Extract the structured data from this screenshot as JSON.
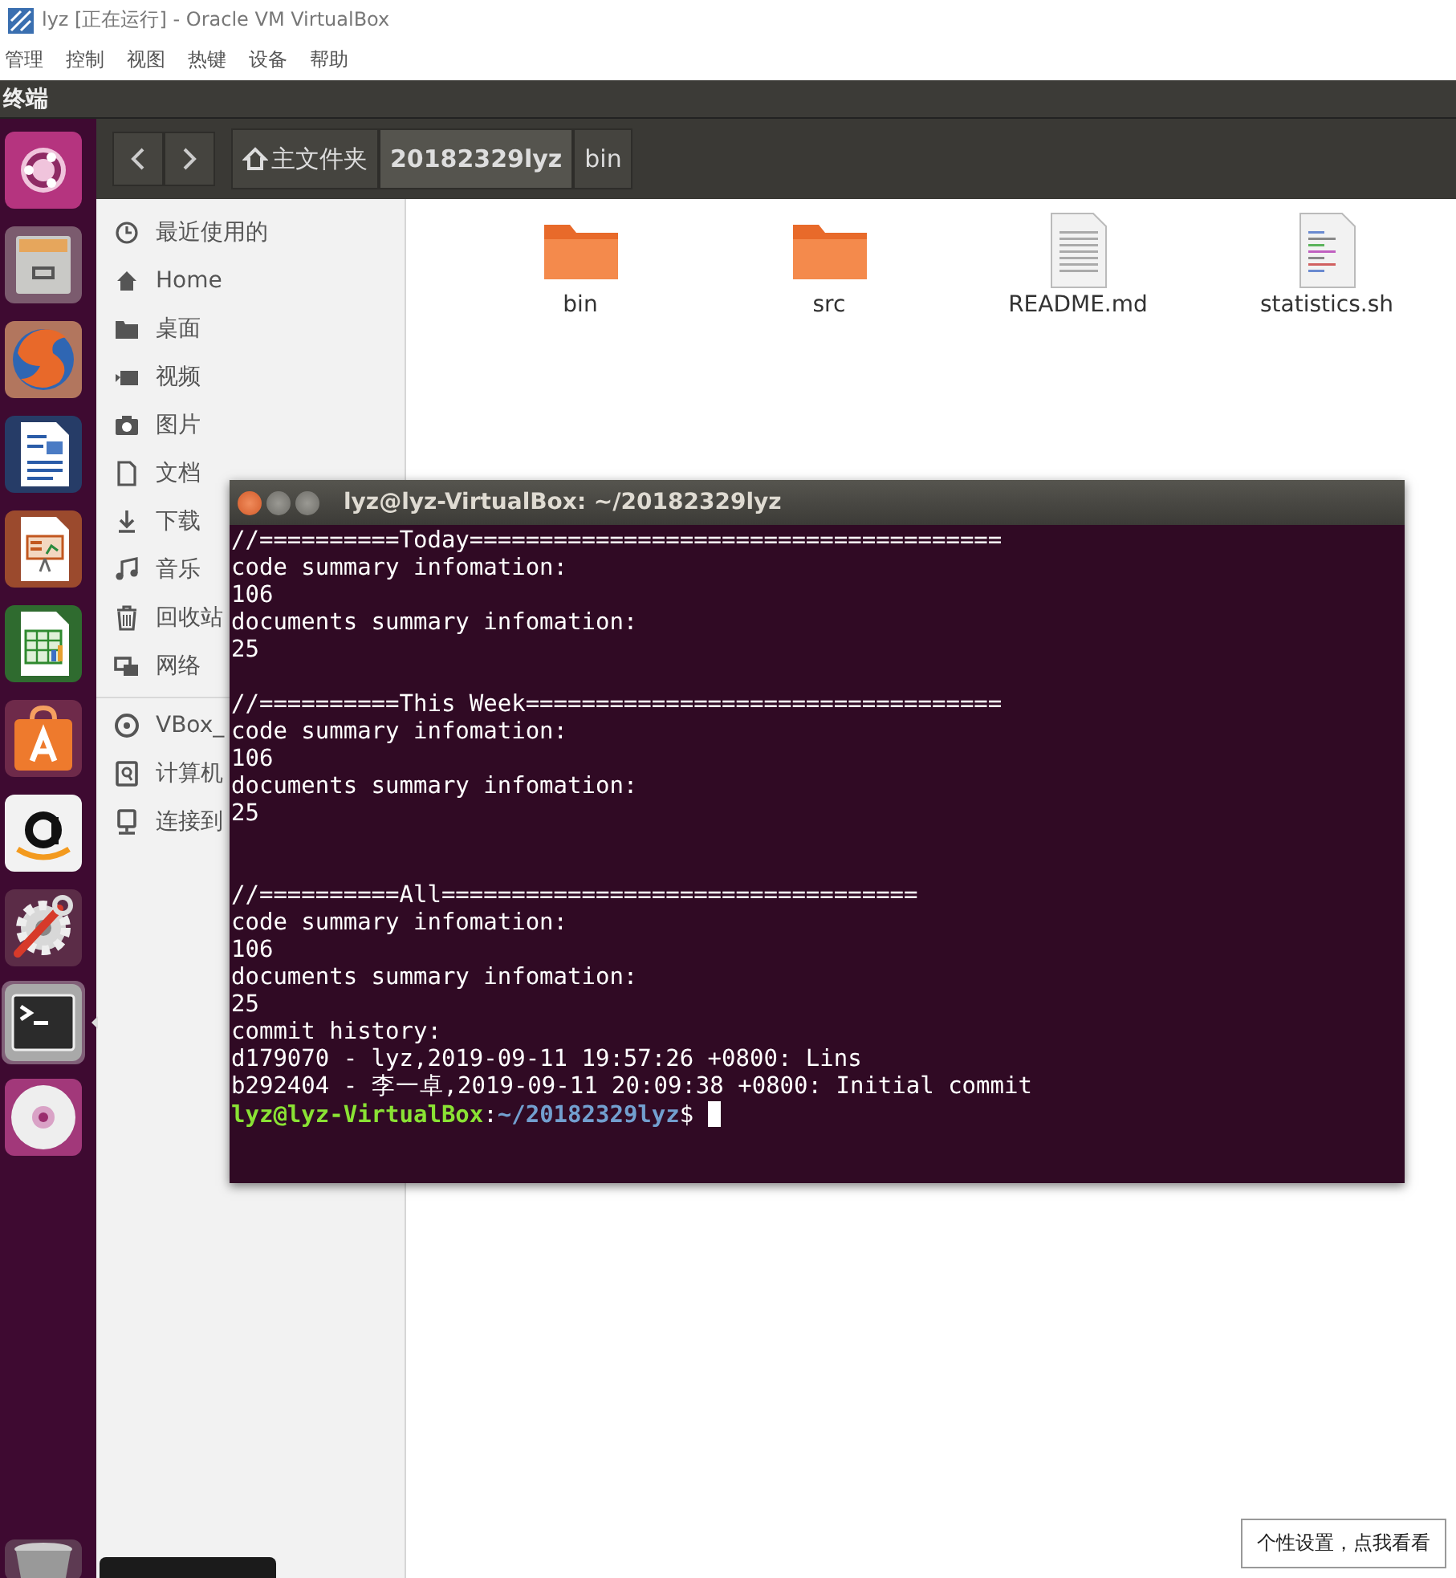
{
  "host_window": {
    "title": "lyz [正在运行] - Oracle VM VirtualBox",
    "menu": [
      "管理",
      "控制",
      "视图",
      "热键",
      "设备",
      "帮助"
    ]
  },
  "top_panel": {
    "title": "终端"
  },
  "launcher": [
    {
      "selected": false
    },
    {
      "selected": false
    },
    {
      "selected": false
    },
    {
      "selected": false
    },
    {
      "selected": false
    },
    {
      "selected": false
    },
    {
      "selected": false
    },
    {
      "selected": false
    },
    {
      "selected": false
    },
    {
      "selected": true
    },
    {
      "selected": false
    }
  ],
  "file_manager": {
    "breadcrumbs": [
      {
        "label": "主文件夹",
        "selected": false
      },
      {
        "label": "20182329lyz",
        "selected": true
      },
      {
        "label": "bin",
        "selected": false
      }
    ],
    "sidebar": {
      "places": [
        "最近使用的",
        "Home",
        "桌面",
        "视频",
        "图片",
        "文档",
        "下载",
        "音乐",
        "回收站",
        "网络"
      ],
      "devices": [
        "VBox_",
        "计算机",
        "连接到"
      ]
    },
    "files": [
      {
        "name": "bin",
        "kind": "folder"
      },
      {
        "name": "src",
        "kind": "folder"
      },
      {
        "name": "README.md",
        "kind": "document"
      },
      {
        "name": "statistics.sh",
        "kind": "script"
      }
    ]
  },
  "terminal": {
    "title": "lyz@lyz-VirtualBox: ~/20182329lyz",
    "lines": [
      {
        "kind": "text",
        "text": "//==========Today======================================"
      },
      {
        "kind": "text",
        "text": "code summary infomation:"
      },
      {
        "kind": "text",
        "text": "106"
      },
      {
        "kind": "text",
        "text": "documents summary infomation:"
      },
      {
        "kind": "text",
        "text": "25"
      },
      {
        "kind": "blank"
      },
      {
        "kind": "text",
        "text": "//==========This Week=================================="
      },
      {
        "kind": "text",
        "text": "code summary infomation:"
      },
      {
        "kind": "text",
        "text": "106"
      },
      {
        "kind": "text",
        "text": "documents summary infomation:"
      },
      {
        "kind": "text",
        "text": "25"
      },
      {
        "kind": "blank"
      },
      {
        "kind": "blank"
      },
      {
        "kind": "text",
        "text": "//==========All=================================="
      },
      {
        "kind": "text",
        "text": "code summary infomation:"
      },
      {
        "kind": "text",
        "text": "106"
      },
      {
        "kind": "text",
        "text": "documents summary infomation:"
      },
      {
        "kind": "text",
        "text": "25"
      },
      {
        "kind": "text",
        "text": "commit history:"
      },
      {
        "kind": "text",
        "text": "d179070 - lyz,2019-09-11 19:57:26 +0800: Lins"
      },
      {
        "kind": "text",
        "text": "b292404 - 李一卓,2019-09-11 20:09:38 +0800: Initial commit"
      },
      {
        "kind": "prompt",
        "user": "lyz@lyz-VirtualBox",
        "separator": ":",
        "path": "~/20182329lyz",
        "symbol": "$"
      }
    ]
  },
  "notification": {
    "text": "个性设置，点我看看"
  }
}
